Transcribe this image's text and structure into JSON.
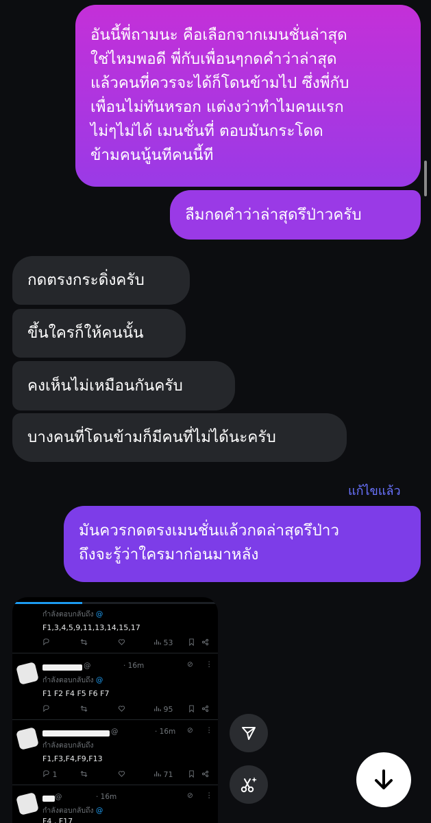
{
  "messages": {
    "out1": {
      "lines": [
        "อันนี้พี่ถามนะ คือเลือกจากเมนชั่นล่าสุด",
        "ใช่ไหมพอดี พี่กับเพื่อนๆกดคำว่าล่าสุด",
        "แล้วคนที่ควรจะได้ก็โดนข้ามไป ซึ่งพี่กับ",
        "เพื่อนไม่ทันหรอก แต่งงว่าทำไมคนแรก",
        "ไม่ๆไม่ได้ เมนชั่นที่     ตอบมันกระโดด",
        "ข้ามคนนู้นทีคนนี้ที"
      ]
    },
    "out2": "ลืมกดคำว่าล่าสุดรึป่าวครับ",
    "in1": "กดตรงกระดิ่งครับ",
    "in2": "ขึ้นใครก็ให้คนนั้น",
    "in3": "คงเห็นไม่เหมือนกันครับ",
    "in4": "บางคนที่โดนข้ามก็มีคนที่ไม่ได้นะครับ",
    "edited_label": "แก้ไขแล้ว",
    "out3": {
      "lines": [
        "มันควรกดตรงเมนชั่นแล้วกดล่าสุดรึป่าว",
        "ถึงจะรู้ว่าใครมาก่อนมาหลัง"
      ]
    }
  },
  "screenshot": {
    "progress": 0.34,
    "tweets": [
      {
        "time": "",
        "reply_prefix": "กำลังตอบกลับถึง",
        "reply_at": "@",
        "content": "F1,3,4,5,9,11,13,14,15,17",
        "views": "53",
        "replies": ""
      },
      {
        "handle_at": "@",
        "time": "· 16m",
        "reply_prefix": "กำลังตอบกลับถึง",
        "reply_at": "@",
        "content": "F1 F2 F4 F5 F6 F7",
        "views": "95",
        "replies": ""
      },
      {
        "handle_at": "@",
        "time": "· 16m",
        "reply_prefix": "กำลังตอบกลับถึง",
        "reply_at": "",
        "content": "F1,F3,F4,F9,F13",
        "views": "71",
        "replies": "1"
      },
      {
        "handle_at": "@",
        "time": "· 16m",
        "reply_prefix": "กำลังตอบกลับถึง",
        "reply_at": "@",
        "content": "F4 , F17"
      }
    ]
  },
  "icons": {
    "send": "send-icon",
    "ai_edit": "scissors-sparkle-icon",
    "scroll_down": "arrow-down-icon"
  },
  "colors": {
    "background": "#0c0d10",
    "outgoing_top": "#c430d8",
    "outgoing_bottom": "#7d3de8",
    "incoming": "#25272b",
    "edited_link": "#6a73ff",
    "twitter_blue": "#1d9bf0"
  }
}
